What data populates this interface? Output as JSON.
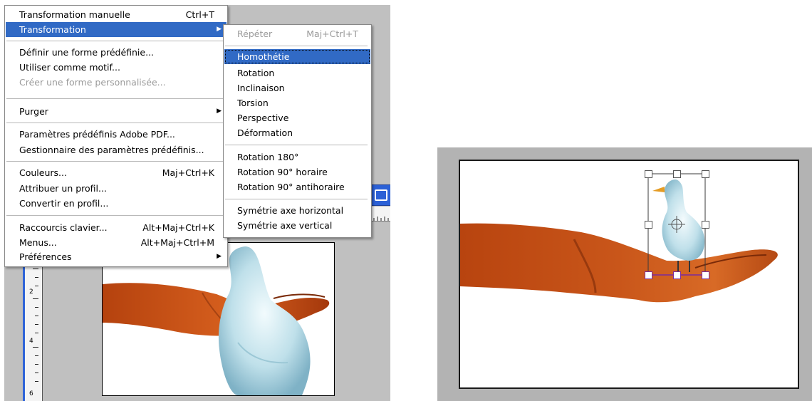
{
  "colors": {
    "menu_highlight": "#316ac5",
    "menu_text_disabled": "#9a9a9a",
    "app_background": "#c0c0c0",
    "ruler_blue": "#2f64d8"
  },
  "main_menu": {
    "items": [
      {
        "label": "Transformation manuelle",
        "shortcut": "Ctrl+T"
      },
      {
        "label": "Transformation",
        "submenu_arrow": "▶"
      },
      {
        "label": "Définir une forme prédéfinie..."
      },
      {
        "label": "Utiliser comme motif..."
      },
      {
        "label": "Créer une forme personnalisée..."
      },
      {
        "label": "Purger",
        "submenu_arrow": "▶"
      },
      {
        "label": "Paramètres prédéfinis Adobe PDF..."
      },
      {
        "label": "Gestionnaire des paramètres prédéfinis..."
      },
      {
        "label": "Couleurs...",
        "shortcut": "Maj+Ctrl+K"
      },
      {
        "label": "Attribuer un profil..."
      },
      {
        "label": "Convertir en profil..."
      },
      {
        "label": "Raccourcis clavier...",
        "shortcut": "Alt+Maj+Ctrl+K"
      },
      {
        "label": "Menus...",
        "shortcut": "Alt+Maj+Ctrl+M"
      },
      {
        "label": "Préférences",
        "submenu_arrow": "▶"
      }
    ]
  },
  "sub_menu": {
    "items": [
      {
        "label": "Répéter",
        "shortcut": "Maj+Ctrl+T"
      },
      {
        "label": "Homothétie"
      },
      {
        "label": "Rotation"
      },
      {
        "label": "Inclinaison"
      },
      {
        "label": "Torsion"
      },
      {
        "label": "Perspective"
      },
      {
        "label": "Déformation"
      },
      {
        "label": "Rotation 180°"
      },
      {
        "label": "Rotation 90° horaire"
      },
      {
        "label": "Rotation 90° antihoraire"
      },
      {
        "label": "Symétrie axe horizontal"
      },
      {
        "label": "Symétrie axe vertical"
      }
    ]
  },
  "ruler": {
    "marks": [
      "2",
      "4",
      "6"
    ]
  },
  "icons": {
    "window_button": "window-restore-icon",
    "transform_center": "crosshair-icon"
  }
}
